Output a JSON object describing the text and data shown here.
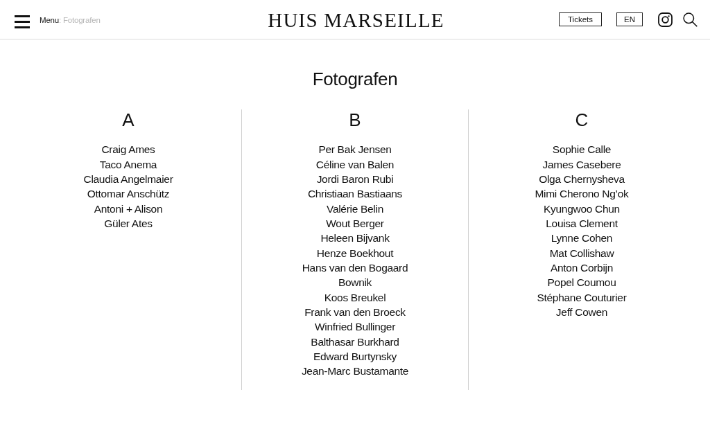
{
  "header": {
    "breadcrumb": {
      "parent": "Menu",
      "separator": ":",
      "current": "Fotografen"
    },
    "logo": "HUIS MARSEILLE",
    "buttons": [
      "Tickets",
      "EN"
    ]
  },
  "page_title": "Fotografen",
  "columns": [
    {
      "letter": "A",
      "names": [
        "Craig Ames",
        "Taco Anema",
        "Claudia Angelmaier",
        "Ottomar Anschütz",
        "Antoni + Alison",
        "Güler Ates"
      ]
    },
    {
      "letter": "B",
      "names": [
        "Per Bak Jensen",
        "Céline van Balen",
        "Jordi Baron Rubi",
        "Christiaan Bastiaans",
        "Valérie Belin",
        "Wout Berger",
        "Heleen Bijvank",
        "Henze Boekhout",
        "Hans van den Bogaard",
        "Bownik",
        "Koos Breukel",
        "Frank van den Broeck",
        "Winfried Bullinger",
        "Balthasar Burkhard",
        "Edward Burtynsky",
        "Jean-Marc Bustamante"
      ]
    },
    {
      "letter": "C",
      "names": [
        "Sophie Calle",
        "James Casebere",
        "Olga Chernysheva",
        "Mimi Cherono Ng’ok",
        "Kyungwoo Chun",
        "Louisa Clement",
        "Lynne Cohen",
        "Mat Collishaw",
        "Anton Corbijn",
        "Popel Coumou",
        "Stéphane Couturier",
        "Jeff Cowen"
      ]
    }
  ]
}
